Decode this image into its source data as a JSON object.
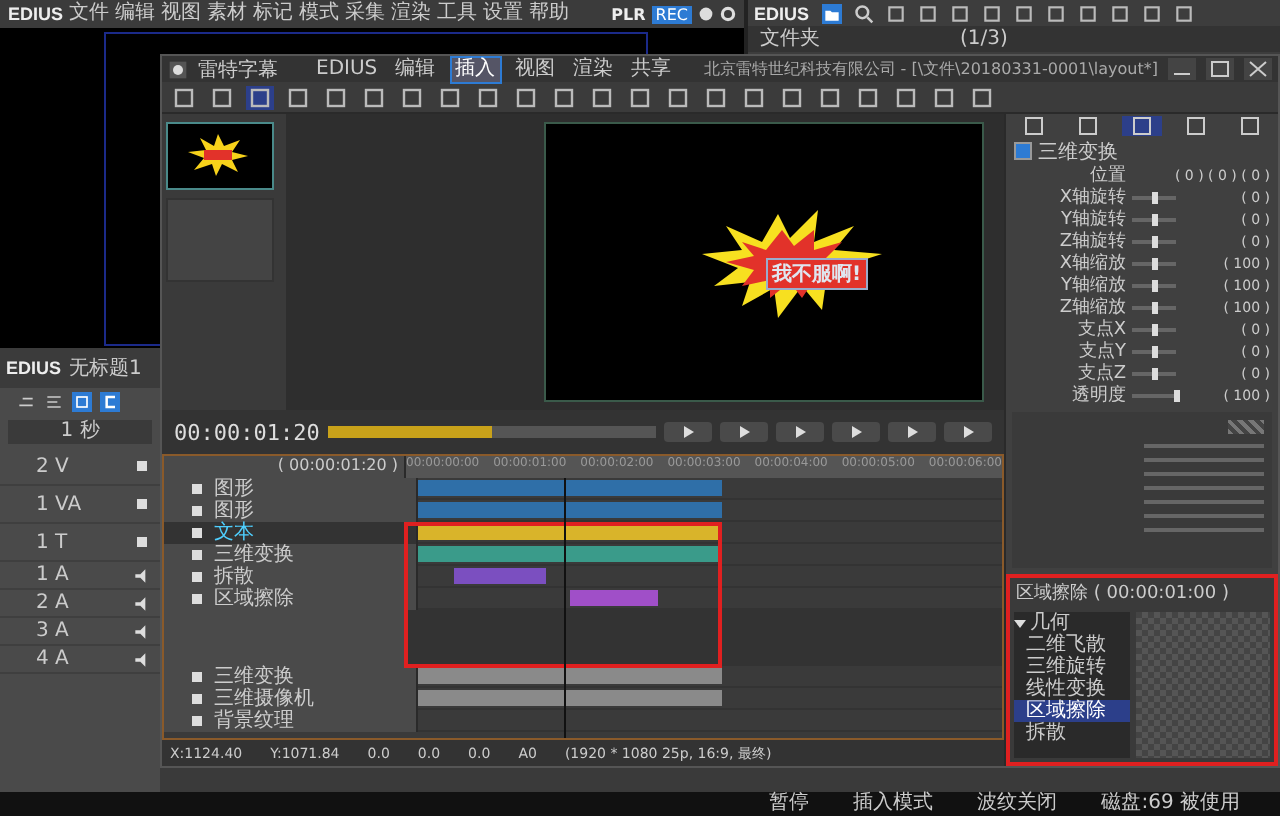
{
  "menubar": {
    "logo": "EDIUS",
    "items": [
      "文件",
      "编辑",
      "视图",
      "素材",
      "标记",
      "模式",
      "采集",
      "渲染",
      "工具",
      "设置",
      "帮助"
    ],
    "plr": "PLR",
    "rec": "REC"
  },
  "bin": {
    "logo": "EDIUS",
    "folder": "文件夹",
    "count": "(1/3)"
  },
  "track_panel": {
    "logo": "EDIUS",
    "project": "无标题1",
    "scale": "1 秒",
    "tracks": [
      {
        "label": "2 V",
        "kind": "video"
      },
      {
        "label": "1 VA",
        "kind": "video"
      },
      {
        "label": "1 T",
        "kind": "title"
      },
      {
        "label": "1 A",
        "kind": "audio"
      },
      {
        "label": "2 A",
        "kind": "audio"
      },
      {
        "label": "3 A",
        "kind": "audio"
      },
      {
        "label": "4 A",
        "kind": "audio"
      }
    ]
  },
  "designer": {
    "title": "雷特字幕",
    "tabs": [
      {
        "label": "EDIUS",
        "selected": false
      },
      {
        "label": "编辑",
        "selected": false
      },
      {
        "label": "插入",
        "selected": true
      },
      {
        "label": "视图",
        "selected": false
      },
      {
        "label": "渲染",
        "selected": false
      },
      {
        "label": "共享",
        "selected": false
      }
    ],
    "path": "北京雷特世纪科技有限公司 - [\\文件\\20180331-0001\\layout*]",
    "caption": "我不服啊!",
    "timecode": "00:00:01:20",
    "timeline": {
      "timecode": "( 00:00:01:20 )",
      "ruler": [
        "00:00:00:00",
        "00:00:01:00",
        "00:00:02:00",
        "00:00:03:00",
        "00:00:04:00",
        "00:00:05:00",
        "00:00:06:00"
      ],
      "layers": [
        {
          "name": "图形",
          "selected": false,
          "color": "#2f6fa8"
        },
        {
          "name": "图形",
          "selected": false,
          "color": "#2f6fa8"
        },
        {
          "name": "文本",
          "selected": true,
          "color": "#d9b42a"
        },
        {
          "name": "三维变换",
          "selected": false,
          "color": "#3a9b8a"
        },
        {
          "name": "拆散",
          "selected": false,
          "color": "#7b4fc0"
        },
        {
          "name": "区域擦除",
          "selected": false,
          "color": "#a04fc8"
        }
      ],
      "bottom_layers": [
        "三维变换",
        "三维摄像机",
        "背景纹理"
      ]
    },
    "status": [
      "X:1124.40",
      "Y:1071.84",
      "0.0",
      "0.0",
      "0.0",
      "A0",
      "(1920 * 1080 25p, 16:9, 最终)"
    ]
  },
  "properties": {
    "section": "三维变换",
    "checked": true,
    "rows": [
      {
        "label": "位置",
        "value": "( 0 ) ( 0 ) ( 0 )",
        "kind": "vector"
      },
      {
        "label": "X轴旋转",
        "value": "( 0 )",
        "kind": "slider",
        "level": 0.5
      },
      {
        "label": "Y轴旋转",
        "value": "( 0 )",
        "kind": "slider",
        "level": 0.5
      },
      {
        "label": "Z轴旋转",
        "value": "( 0 )",
        "kind": "slider",
        "level": 0.5
      },
      {
        "label": "X轴缩放",
        "value": "( 100 )",
        "kind": "slider",
        "level": 0.5
      },
      {
        "label": "Y轴缩放",
        "value": "( 100 )",
        "kind": "slider",
        "level": 0.5
      },
      {
        "label": "Z轴缩放",
        "value": "( 100 )",
        "kind": "slider",
        "level": 0.5
      },
      {
        "label": "支点X",
        "value": "( 0 )",
        "kind": "slider",
        "level": 0.5
      },
      {
        "label": "支点Y",
        "value": "( 0 )",
        "kind": "slider",
        "level": 0.5
      },
      {
        "label": "支点Z",
        "value": "( 0 )",
        "kind": "slider",
        "level": 0.5
      },
      {
        "label": "透明度",
        "value": "( 100 )",
        "kind": "slider",
        "level": 1
      }
    ]
  },
  "effects": {
    "title": "区域擦除 ( 00:00:01:00 )",
    "tree": [
      {
        "label": "几何",
        "expanded": true,
        "selected": false,
        "children": [
          {
            "label": "二维飞散",
            "selected": false
          },
          {
            "label": "三维旋转",
            "selected": false
          },
          {
            "label": "线性变换",
            "selected": false
          },
          {
            "label": "区域擦除",
            "selected": true
          },
          {
            "label": "拆散",
            "selected": false
          }
        ]
      }
    ]
  },
  "status_bar": [
    "暂停",
    "插入模式",
    "波纹关闭",
    "磁盘:69 被使用"
  ]
}
